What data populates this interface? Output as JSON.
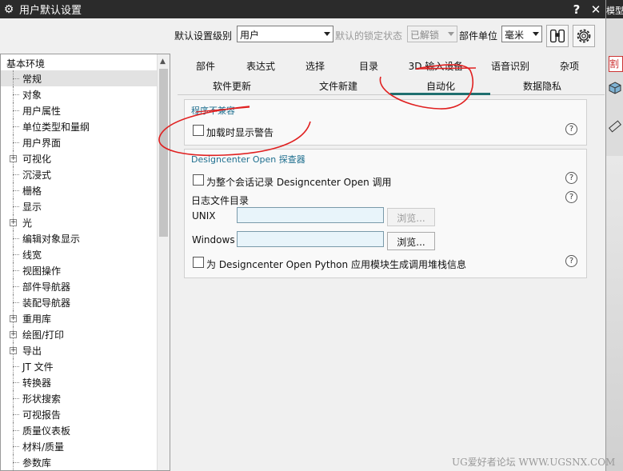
{
  "window": {
    "title": "用户默认设置",
    "help_glyph": "?",
    "close_glyph": "✕"
  },
  "side_app": {
    "title_fragment": "模型",
    "toolbar_char": "割"
  },
  "toolbar": {
    "level_label": "默认设置级别",
    "level_value": "用户",
    "locked_label": "默认的锁定状态",
    "locked_value": "已解锁",
    "unit_label": "部件单位",
    "unit_value": "毫米"
  },
  "tree": {
    "root": "基本环境",
    "items": [
      {
        "label": "常规",
        "selected": true,
        "expandable": false
      },
      {
        "label": "对象",
        "expandable": false
      },
      {
        "label": "用户属性",
        "expandable": false
      },
      {
        "label": "单位类型和量纲",
        "expandable": false
      },
      {
        "label": "用户界面",
        "expandable": false
      },
      {
        "label": "可视化",
        "expandable": true
      },
      {
        "label": "沉浸式",
        "expandable": false
      },
      {
        "label": "栅格",
        "expandable": false
      },
      {
        "label": "显示",
        "expandable": false
      },
      {
        "label": "光",
        "expandable": true
      },
      {
        "label": "编辑对象显示",
        "expandable": false
      },
      {
        "label": "线宽",
        "expandable": false
      },
      {
        "label": "视图操作",
        "expandable": false
      },
      {
        "label": "部件导航器",
        "expandable": false
      },
      {
        "label": "装配导航器",
        "expandable": false
      },
      {
        "label": "重用库",
        "expandable": true
      },
      {
        "label": "绘图/打印",
        "expandable": true
      },
      {
        "label": "导出",
        "expandable": true
      },
      {
        "label": "JT 文件",
        "expandable": false
      },
      {
        "label": "转换器",
        "expandable": false
      },
      {
        "label": "形状搜索",
        "expandable": false
      },
      {
        "label": "可视报告",
        "expandable": false
      },
      {
        "label": "质量仪表板",
        "expandable": false
      },
      {
        "label": "材料/质量",
        "expandable": false
      },
      {
        "label": "参数库",
        "expandable": false
      }
    ]
  },
  "tabs": {
    "row1": [
      "部件",
      "表达式",
      "选择",
      "目录",
      "3D 输入设备",
      "语音识别",
      "杂项"
    ],
    "row2": [
      "软件更新",
      "文件新建",
      "自动化",
      "数据隐私"
    ],
    "active": "自动化"
  },
  "group_compat": {
    "title": "程序不兼容",
    "checkbox_label": "加载时显示警告",
    "checked": false
  },
  "group_designcenter": {
    "title": "Designcenter Open 探查器",
    "session_log_label": "为整个会话记录 Designcenter Open 调用",
    "log_dir_label": "日志文件目录",
    "unix_label": "UNIX",
    "unix_value": "",
    "unix_browse": "浏览...",
    "windows_label": "Windows",
    "windows_value": "",
    "windows_browse": "浏览...",
    "python_trace_label": "为 Designcenter Open Python 应用模块生成调用堆栈信息"
  },
  "help_glyph": "?",
  "watermark": "UG爱好者论坛 WWW.UGSNX.COM"
}
